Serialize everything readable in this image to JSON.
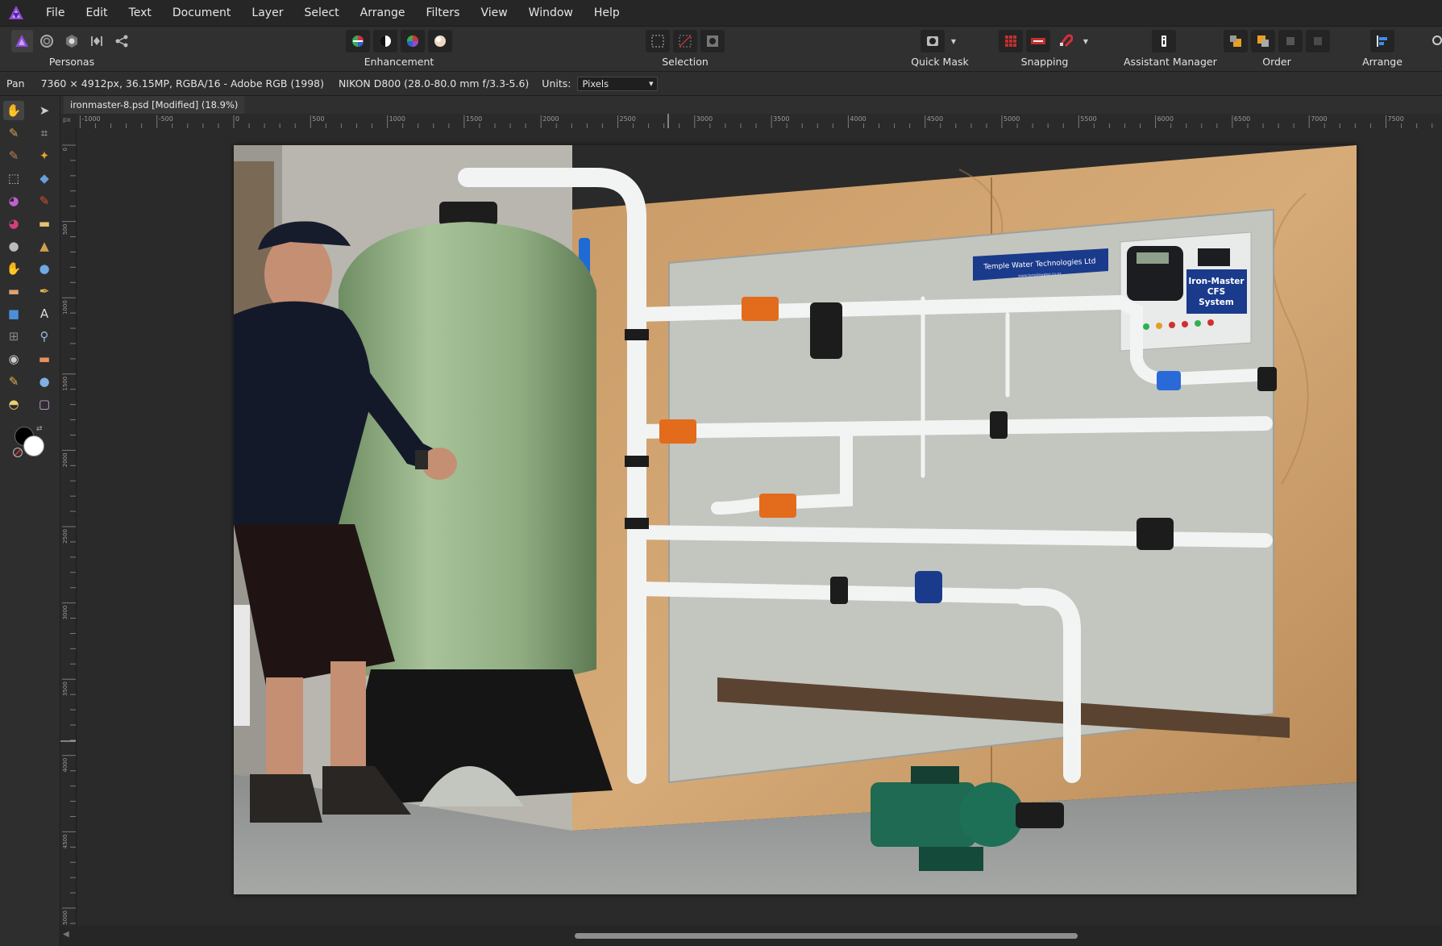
{
  "app": {
    "name": "Affinity Photo",
    "accent": "#8b4cd8"
  },
  "menu": [
    "File",
    "Edit",
    "Text",
    "Document",
    "Layer",
    "Select",
    "Arrange",
    "Filters",
    "View",
    "Window",
    "Help"
  ],
  "toolbar": {
    "personas_label": "Personas",
    "personas_icons": [
      "photo-persona-icon",
      "liquify-persona-icon",
      "develop-persona-icon",
      "tone-mapping-persona-icon",
      "export-persona-icon"
    ],
    "enhancement_label": "Enhancement",
    "enhancement_icons": [
      "auto-levels-icon",
      "auto-contrast-icon",
      "auto-colors-icon",
      "auto-white-balance-icon"
    ],
    "selection_label": "Selection",
    "selection_icons": [
      "select-all-icon",
      "deselect-icon",
      "invert-selection-icon"
    ],
    "quickmask_label": "Quick Mask",
    "snapping_label": "Snapping",
    "assistant_label": "Assistant Manager",
    "order_label": "Order",
    "arrange_label": "Arrange"
  },
  "contextbar": {
    "tool_name": "Pan",
    "doc_info": "7360 × 4912px, 36.15MP, RGBA/16 - Adobe RGB (1998)",
    "camera_info": "NIKON D800 (28.0-80.0 mm f/3.3-5.6)",
    "units_label": "Units:",
    "units_value": "Pixels"
  },
  "tools": [
    {
      "name": "view-tool-icon",
      "active": true
    },
    {
      "name": "move-tool-icon"
    },
    {
      "name": "color-picker-tool-icon"
    },
    {
      "name": "crop-tool-icon"
    },
    {
      "name": "selection-brush-tool-icon"
    },
    {
      "name": "flood-select-tool-icon"
    },
    {
      "name": "marquee-tool-icon"
    },
    {
      "name": "flood-fill-tool-icon"
    },
    {
      "name": "gradient-tool-icon"
    },
    {
      "name": "paint-brush-tool-icon"
    },
    {
      "name": "color-replacement-tool-icon"
    },
    {
      "name": "erase-brush-tool-icon"
    },
    {
      "name": "dodge-tool-icon"
    },
    {
      "name": "clone-brush-tool-icon"
    },
    {
      "name": "smudge-tool-icon"
    },
    {
      "name": "blur-brush-tool-icon"
    },
    {
      "name": "healing-brush-tool-icon"
    },
    {
      "name": "pen-tool-icon"
    },
    {
      "name": "rectangle-tool-icon"
    },
    {
      "name": "artistic-text-tool-icon"
    },
    {
      "name": "mesh-warp-tool-icon"
    },
    {
      "name": "zoom-tool-icon"
    },
    {
      "name": "red-eye-tool-icon"
    },
    {
      "name": "patch-tool-icon"
    },
    {
      "name": "inpainting-brush-tool-icon"
    },
    {
      "name": "sharpen-brush-tool-icon"
    },
    {
      "name": "frequency-separation-tool-icon"
    },
    {
      "name": "node-tool-icon"
    }
  ],
  "colors": {
    "primary": "#000000",
    "secondary": "#ffffff"
  },
  "document": {
    "tab_title": "ironmaster-8.psd [Modified] (18.9%)"
  },
  "ruler": {
    "unit": "px",
    "h_ticks": [
      "-1000",
      "-500",
      "0",
      "500",
      "1000",
      "1500",
      "2000",
      "2500",
      "3000",
      "3500",
      "4000",
      "4500",
      "5000",
      "5500",
      "6000",
      "6500",
      "7000",
      "7500"
    ],
    "v_ticks": [
      "0",
      "500",
      "1000",
      "1500",
      "2000",
      "2500",
      "3000",
      "3500",
      "4000",
      "4500",
      "5000"
    ]
  },
  "photo": {
    "sign_company": "Temple Water Technologies Ltd",
    "sign_small": "www.templewater.co.nz",
    "system_label_lines": [
      "Iron-Master",
      "CFS",
      "System"
    ]
  }
}
